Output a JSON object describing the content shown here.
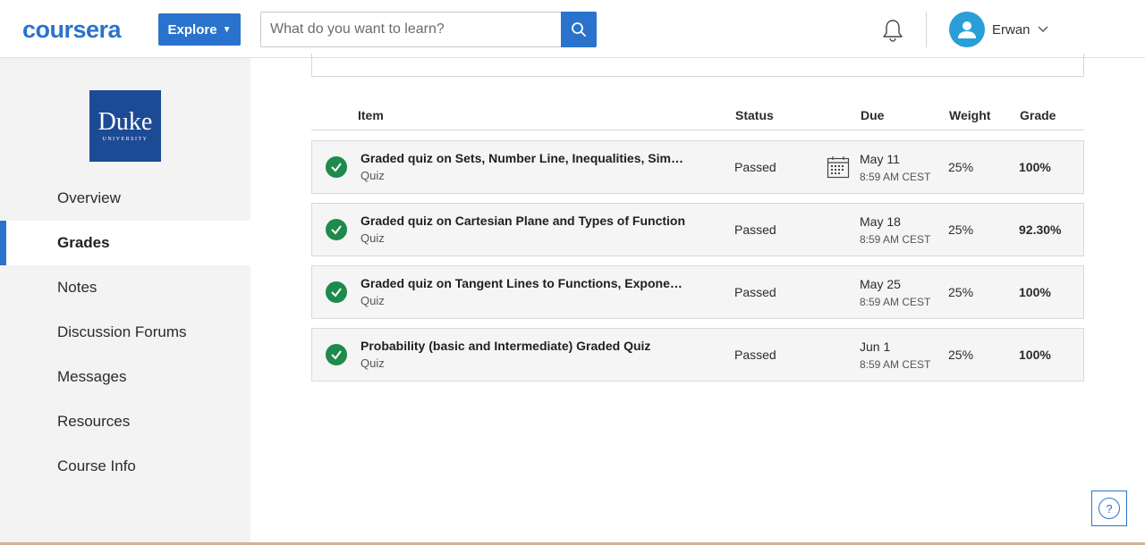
{
  "header": {
    "logo": "coursera",
    "explore_label": "Explore",
    "search_placeholder": "What do you want to learn?",
    "user_name": "Erwan"
  },
  "sidebar": {
    "university_logo": {
      "name": "Duke",
      "sub": "UNIVERSITY"
    },
    "items": [
      {
        "label": "Overview"
      },
      {
        "label": "Grades"
      },
      {
        "label": "Notes"
      },
      {
        "label": "Discussion Forums"
      },
      {
        "label": "Messages"
      },
      {
        "label": "Resources"
      },
      {
        "label": "Course Info"
      }
    ],
    "active_item": "Grades"
  },
  "grades_table": {
    "headers": {
      "item": "Item",
      "status": "Status",
      "due": "Due",
      "weight": "Weight",
      "grade": "Grade"
    },
    "rows": [
      {
        "title": "Graded quiz on Sets, Number Line, Inequalities, Simplification, and Sigma Notation",
        "type": "Quiz",
        "status": "Passed",
        "due_date": "May 11",
        "due_time": "8:59 AM CEST",
        "weight": "25%",
        "grade": "100%"
      },
      {
        "title": "Graded quiz on Cartesian Plane and Types of Function",
        "type": "Quiz",
        "status": "Passed",
        "due_date": "May 18",
        "due_time": "8:59 AM CEST",
        "weight": "25%",
        "grade": "92.30%"
      },
      {
        "title": "Graded quiz on Tangent Lines to Functions, Exponents and Logarithms",
        "type": "Quiz",
        "status": "Passed",
        "due_date": "May 25",
        "due_time": "8:59 AM CEST",
        "weight": "25%",
        "grade": "100%"
      },
      {
        "title": "Probability (basic and Intermediate) Graded Quiz",
        "type": "Quiz",
        "status": "Passed",
        "due_date": "Jun 1",
        "due_time": "8:59 AM CEST",
        "weight": "25%",
        "grade": "100%"
      }
    ]
  },
  "colors": {
    "brand": "#2a73cc",
    "passed": "#1e8a4c"
  }
}
